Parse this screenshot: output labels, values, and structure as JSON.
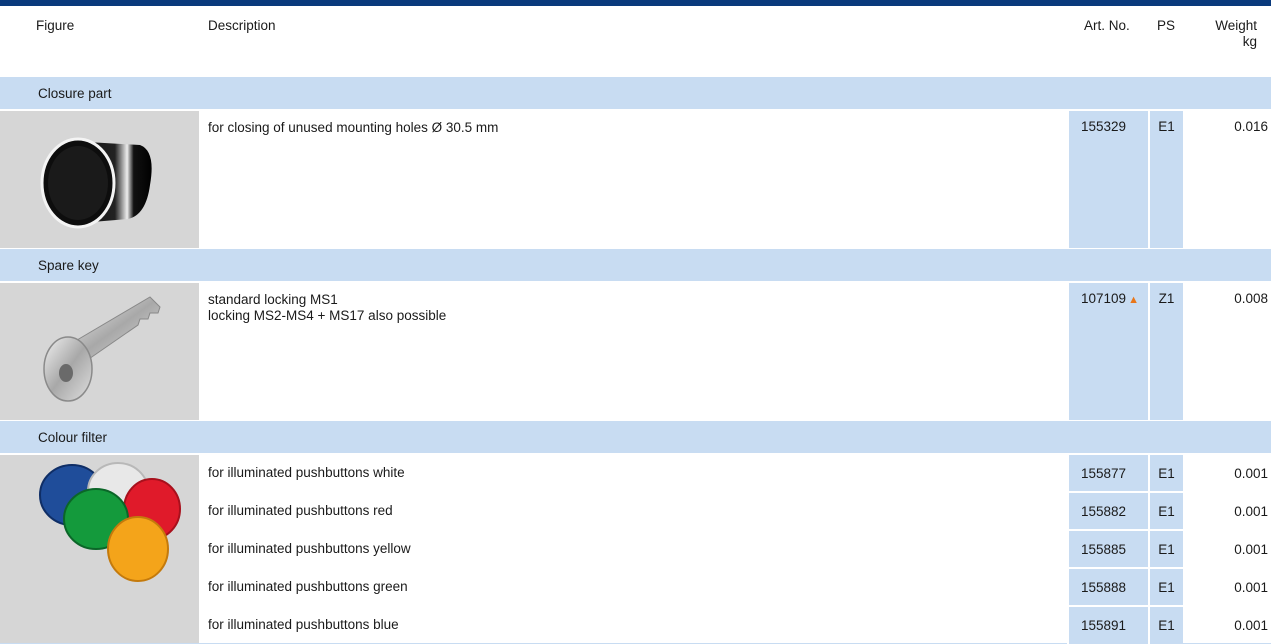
{
  "header": {
    "figure": "Figure",
    "description": "Description",
    "art_no": "Art. No.",
    "ps": "PS",
    "weight_line1": "Weight",
    "weight_line2": "kg"
  },
  "sections": [
    {
      "title": "Closure part",
      "image_icon": "closure-cap-image",
      "rows": [
        {
          "description": "for closing of unused mounting holes Ø 30.5 mm",
          "art_no": "155329",
          "ps": "E1",
          "weight": "0.016"
        }
      ]
    },
    {
      "title": "Spare key",
      "image_icon": "key-image",
      "rows": [
        {
          "description_line1": "standard locking MS1",
          "description_line2": "locking MS2-MS4 + MS17 also possible",
          "art_no": "107109",
          "ps": "Z1",
          "weight": "0.008"
        }
      ]
    },
    {
      "title": "Colour filter",
      "image_icon": "colour-filter-image",
      "rows": [
        {
          "description": "for illuminated pushbuttons white",
          "art_no": "155877",
          "ps": "E1",
          "weight": "0.001"
        },
        {
          "description": "for illuminated pushbuttons red",
          "art_no": "155882",
          "ps": "E1",
          "weight": "0.001"
        },
        {
          "description": "for illuminated pushbuttons yellow",
          "art_no": "155885",
          "ps": "E1",
          "weight": "0.001"
        },
        {
          "description": "for illuminated pushbuttons green",
          "art_no": "155888",
          "ps": "E1",
          "weight": "0.001"
        },
        {
          "description": "for illuminated pushbuttons blue",
          "art_no": "155891",
          "ps": "E1",
          "weight": "0.001"
        }
      ]
    }
  ],
  "colors": {
    "header_bar": "#0a3a7c",
    "section_bg": "#c8dcf2",
    "figure_bg": "#d6d6d6",
    "availability_marker": "#e8761a"
  },
  "marker_icon": "orange-triangle-icon"
}
